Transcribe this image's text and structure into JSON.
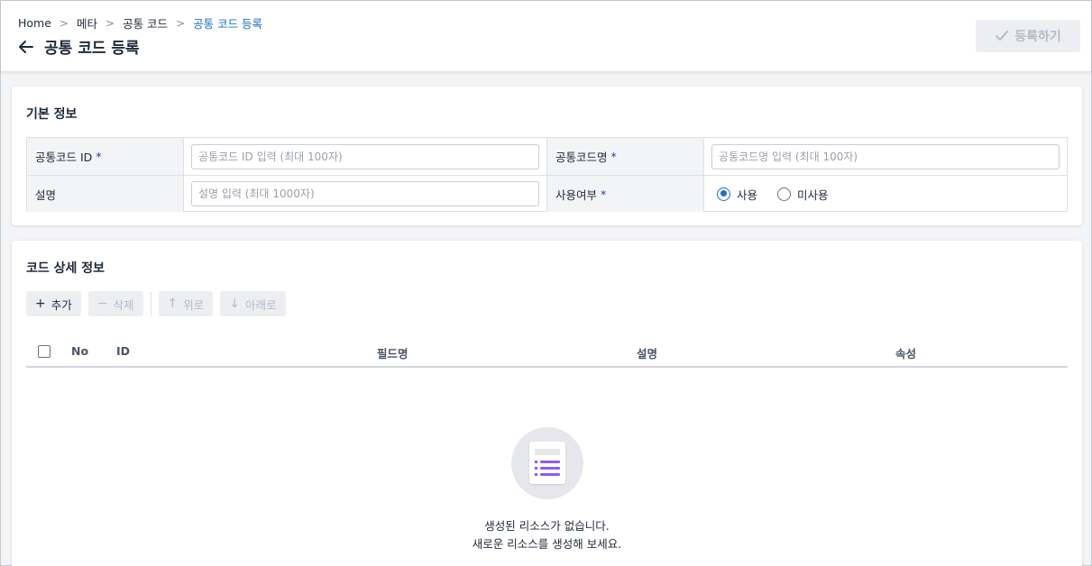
{
  "breadcrumb": [
    "Home",
    "메타",
    "공통 코드",
    "공통 코드 등록"
  ],
  "page_title": "공통 코드 등록",
  "register_button": "등록하기",
  "basic_info": {
    "title": "기본 정보",
    "fields": {
      "code_id": {
        "label": "공통코드 ID",
        "required": "*",
        "placeholder": "공통코드 ID 입력 (최대 100자)"
      },
      "code_name": {
        "label": "공통코드명",
        "required": "*",
        "placeholder": "공통코드명 입력 (최대 100자)"
      },
      "description": {
        "label": "설명",
        "placeholder": "설명 입력 (최대 1000자)"
      },
      "usage": {
        "label": "사용여부",
        "required": "*",
        "options": [
          "사용",
          "미사용"
        ],
        "selected": "사용"
      }
    }
  },
  "detail_info": {
    "title": "코드 상세 정보",
    "toolbar": {
      "add": "추가",
      "delete": "삭제",
      "up": "위로",
      "down": "아래로"
    },
    "columns": [
      "No",
      "ID",
      "필드명",
      "설명",
      "속성"
    ],
    "rows": [],
    "empty_line1": "생성된 리소스가 없습니다.",
    "empty_line2": "새로운 리소스를 생성해 보세요."
  },
  "colors": {
    "accent": "#1f6fbf",
    "required": "#1e40af",
    "empty_icon": "#8b5cf6"
  }
}
